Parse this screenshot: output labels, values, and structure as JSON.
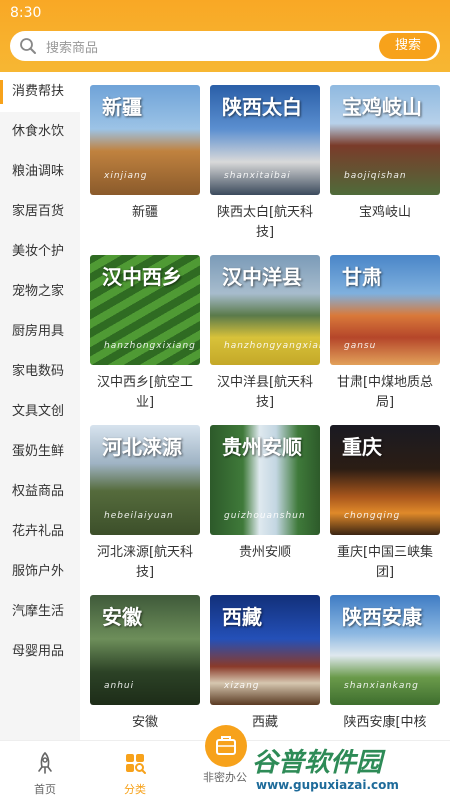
{
  "status": {
    "time": "8:30"
  },
  "search": {
    "placeholder": "搜索商品",
    "button_label": "搜索"
  },
  "sidebar": {
    "items": [
      {
        "label": "消费帮扶",
        "active": true
      },
      {
        "label": "休食水饮"
      },
      {
        "label": "粮油调味"
      },
      {
        "label": "家居百货"
      },
      {
        "label": "美妆个护"
      },
      {
        "label": "宠物之家"
      },
      {
        "label": "厨房用具"
      },
      {
        "label": "家电数码"
      },
      {
        "label": "文具文创"
      },
      {
        "label": "蛋奶生鲜"
      },
      {
        "label": "权益商品"
      },
      {
        "label": "花卉礼品"
      },
      {
        "label": "服饰户外"
      },
      {
        "label": "汽摩生活"
      },
      {
        "label": "母婴用品"
      }
    ]
  },
  "grid": {
    "items": [
      {
        "name": "新疆",
        "pic_title": "新疆",
        "pic_sub": "xinjiang"
      },
      {
        "name": "陕西太白[航天科技]",
        "pic_title": "陕西太白",
        "pic_sub": "shanxitaibai"
      },
      {
        "name": "宝鸡岐山",
        "pic_title": "宝鸡岐山",
        "pic_sub": "baojiqishan"
      },
      {
        "name": "汉中西乡[航空工业]",
        "pic_title": "汉中西乡",
        "pic_sub": "hanzhongxixiang"
      },
      {
        "name": "汉中洋县[航天科技]",
        "pic_title": "汉中洋县",
        "pic_sub": "hanzhongyangxian"
      },
      {
        "name": "甘肃[中煤地质总局]",
        "pic_title": "甘肃",
        "pic_sub": "gansu"
      },
      {
        "name": "河北涞源[航天科技]",
        "pic_title": "河北涞源",
        "pic_sub": "hebeilaiyuan"
      },
      {
        "name": "贵州安顺",
        "pic_title": "贵州安顺",
        "pic_sub": "guizhouanshun"
      },
      {
        "name": "重庆[中国三峡集团]",
        "pic_title": "重庆",
        "pic_sub": "chongqing"
      },
      {
        "name": "安徽",
        "pic_title": "安徽",
        "pic_sub": "anhui"
      },
      {
        "name": "西藏",
        "pic_title": "西藏",
        "pic_sub": "xizang"
      },
      {
        "name": "陕西安康[中核",
        "pic_title": "陕西安康",
        "pic_sub": "shanxiankang"
      }
    ]
  },
  "tabbar": {
    "tabs": [
      {
        "label": "首页",
        "icon": "rocket-icon"
      },
      {
        "label": "分类",
        "icon": "category-grid-icon",
        "active": true
      },
      {
        "label": "非密办公",
        "icon": "briefcase-icon"
      }
    ]
  },
  "watermark": {
    "main": "谷普软件园",
    "sub": "www.gupuxiazai.com"
  },
  "colors": {
    "accent": "#f7a21b",
    "header_start": "#f9a825"
  }
}
